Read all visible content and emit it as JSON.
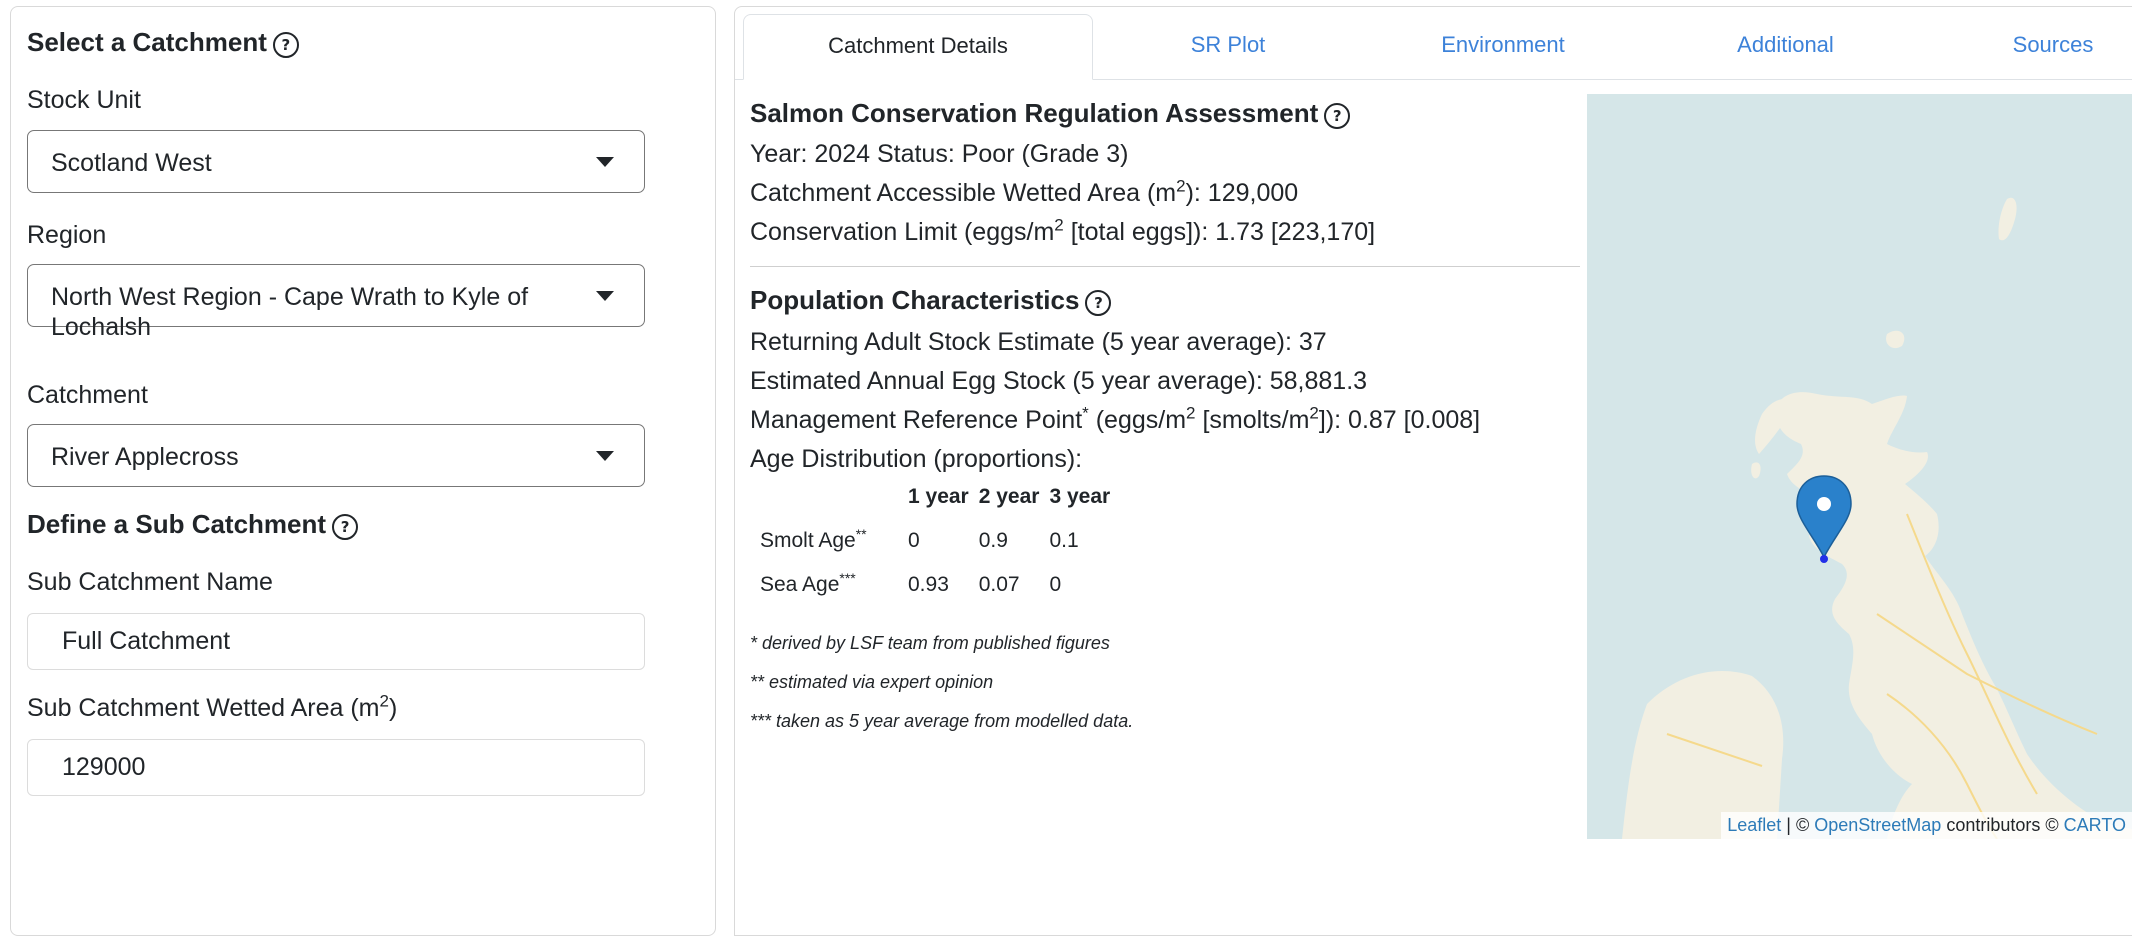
{
  "select_catchment": {
    "title": "Select a Catchment",
    "stock_unit": {
      "label": "Stock Unit",
      "value": "Scotland West"
    },
    "region": {
      "label": "Region",
      "value": "North West Region - Cape Wrath to Kyle of Lochalsh"
    },
    "catchment": {
      "label": "Catchment",
      "value": "River Applecross"
    }
  },
  "sub_catchment": {
    "title": "Define a Sub Catchment",
    "name": {
      "label": "Sub Catchment Name",
      "value": "Full Catchment"
    },
    "wetted_area": {
      "label_prefix": "Sub Catchment Wetted Area (m",
      "label_sup": "2",
      "label_suffix": ")",
      "value": "129000"
    }
  },
  "tabs": [
    {
      "label": "Catchment Details",
      "active": true
    },
    {
      "label": "SR Plot",
      "active": false
    },
    {
      "label": "Environment",
      "active": false
    },
    {
      "label": "Additional",
      "active": false
    },
    {
      "label": "Sources",
      "active": false
    }
  ],
  "assessment": {
    "title": "Salmon Conservation Regulation Assessment",
    "year_status": "Year: 2024 Status: Poor (Grade 3)",
    "wetted_area": {
      "prefix": "Catchment Accessible Wetted Area (m",
      "sup": "2",
      "suffix": "): 129,000"
    },
    "conservation_limit": {
      "prefix": "Conservation Limit (eggs/m",
      "sup": "2",
      "suffix": " [total eggs]): 1.73 [223,170]"
    }
  },
  "population": {
    "title": "Population Characteristics",
    "returning_adults": "Returning Adult Stock Estimate (5 year average): 37",
    "egg_stock": "Estimated Annual Egg Stock (5 year average): 58,881.3",
    "mrp": {
      "prefix": "Management Reference Point",
      "sup1": "*",
      "mid": " (eggs/m",
      "sup2": "2",
      "mid2": " [smolts/m",
      "sup3": "2",
      "suffix": "]): 0.87 [0.008]"
    },
    "age_distribution_label": "Age Distribution (proportions):",
    "age_table": {
      "headers": [
        "",
        "1 year",
        "2 year",
        "3 year"
      ],
      "rows": [
        {
          "label": "Smolt Age",
          "sup": "**",
          "values": [
            "0",
            "0.9",
            "0.1"
          ]
        },
        {
          "label": "Sea Age",
          "sup": "***",
          "values": [
            "0.93",
            "0.07",
            "0"
          ]
        }
      ]
    },
    "footnotes": [
      "* derived by LSF team from published figures",
      "** estimated via expert opinion",
      "*** taken as 5 year average from modelled data."
    ]
  },
  "map": {
    "attribution": {
      "leaflet": "Leaflet",
      "sep": " | © ",
      "osm": "OpenStreetMap",
      "mid": " contributors © ",
      "carto": "CARTO"
    },
    "colors": {
      "sea": "#d5e6e8",
      "land": "#f2efe2",
      "marker": "#2a81cb"
    }
  }
}
